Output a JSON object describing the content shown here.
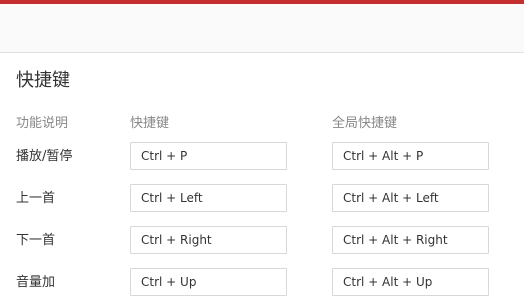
{
  "settings": {
    "section_title": "快捷键",
    "columns": {
      "function": "功能说明",
      "shortcut": "快捷键",
      "global": "全局快捷键"
    },
    "rows": [
      {
        "label": "播放/暂停",
        "shortcut": "Ctrl + P",
        "global": "Ctrl + Alt + P"
      },
      {
        "label": "上一首",
        "shortcut": "Ctrl + Left",
        "global": "Ctrl + Alt + Left"
      },
      {
        "label": "下一首",
        "shortcut": "Ctrl + Right",
        "global": "Ctrl + Alt + Right"
      },
      {
        "label": "音量加",
        "shortcut": "Ctrl + Up",
        "global": "Ctrl + Alt + Up"
      }
    ]
  },
  "colors": {
    "accent": "#c62f2f",
    "text": "#333333",
    "muted": "#888888",
    "border": "#d8d8d8"
  }
}
